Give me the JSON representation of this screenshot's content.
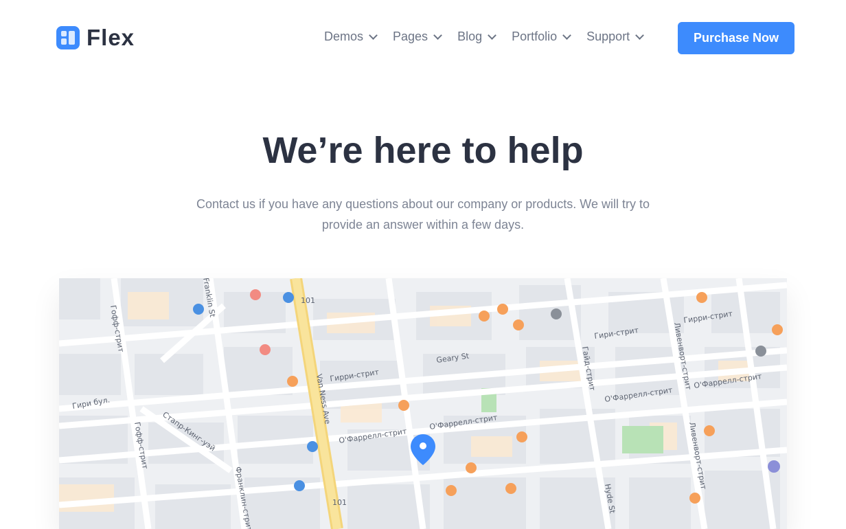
{
  "brand": {
    "name": "Flex",
    "accent": "#3d8bfd"
  },
  "nav": {
    "items": [
      {
        "label": "Demos"
      },
      {
        "label": "Pages"
      },
      {
        "label": "Blog"
      },
      {
        "label": "Portfolio"
      },
      {
        "label": "Support"
      }
    ],
    "cta_label": "Purchase Now"
  },
  "hero": {
    "title": "We’re here to help",
    "text": "Contact us if you have any questions about our company or products. We will try to provide an answer within a few days."
  },
  "map": {
    "streets": [
      "Гофф-стрит",
      "Franklin St",
      "Van Ness Ave",
      "Гири бул.",
      "Гирри-стрит",
      "Geary St",
      "Гири-стрит",
      "Гирри-стрит",
      "Гайд-стрит",
      "Ливенворт-стрит",
      "О'Фаррелл-стрит",
      "О'Фаррелл-стрит",
      "О'Фаррелл-стрит",
      "О'Фаррелл-стрит",
      "Стапр-Кинг-уэй",
      "Гофф-стрит",
      "Франклин-стрит",
      "Hyde St",
      "Ливенворт-стрит",
      "101",
      "101"
    ],
    "marker_icon": "location-pin-icon"
  }
}
